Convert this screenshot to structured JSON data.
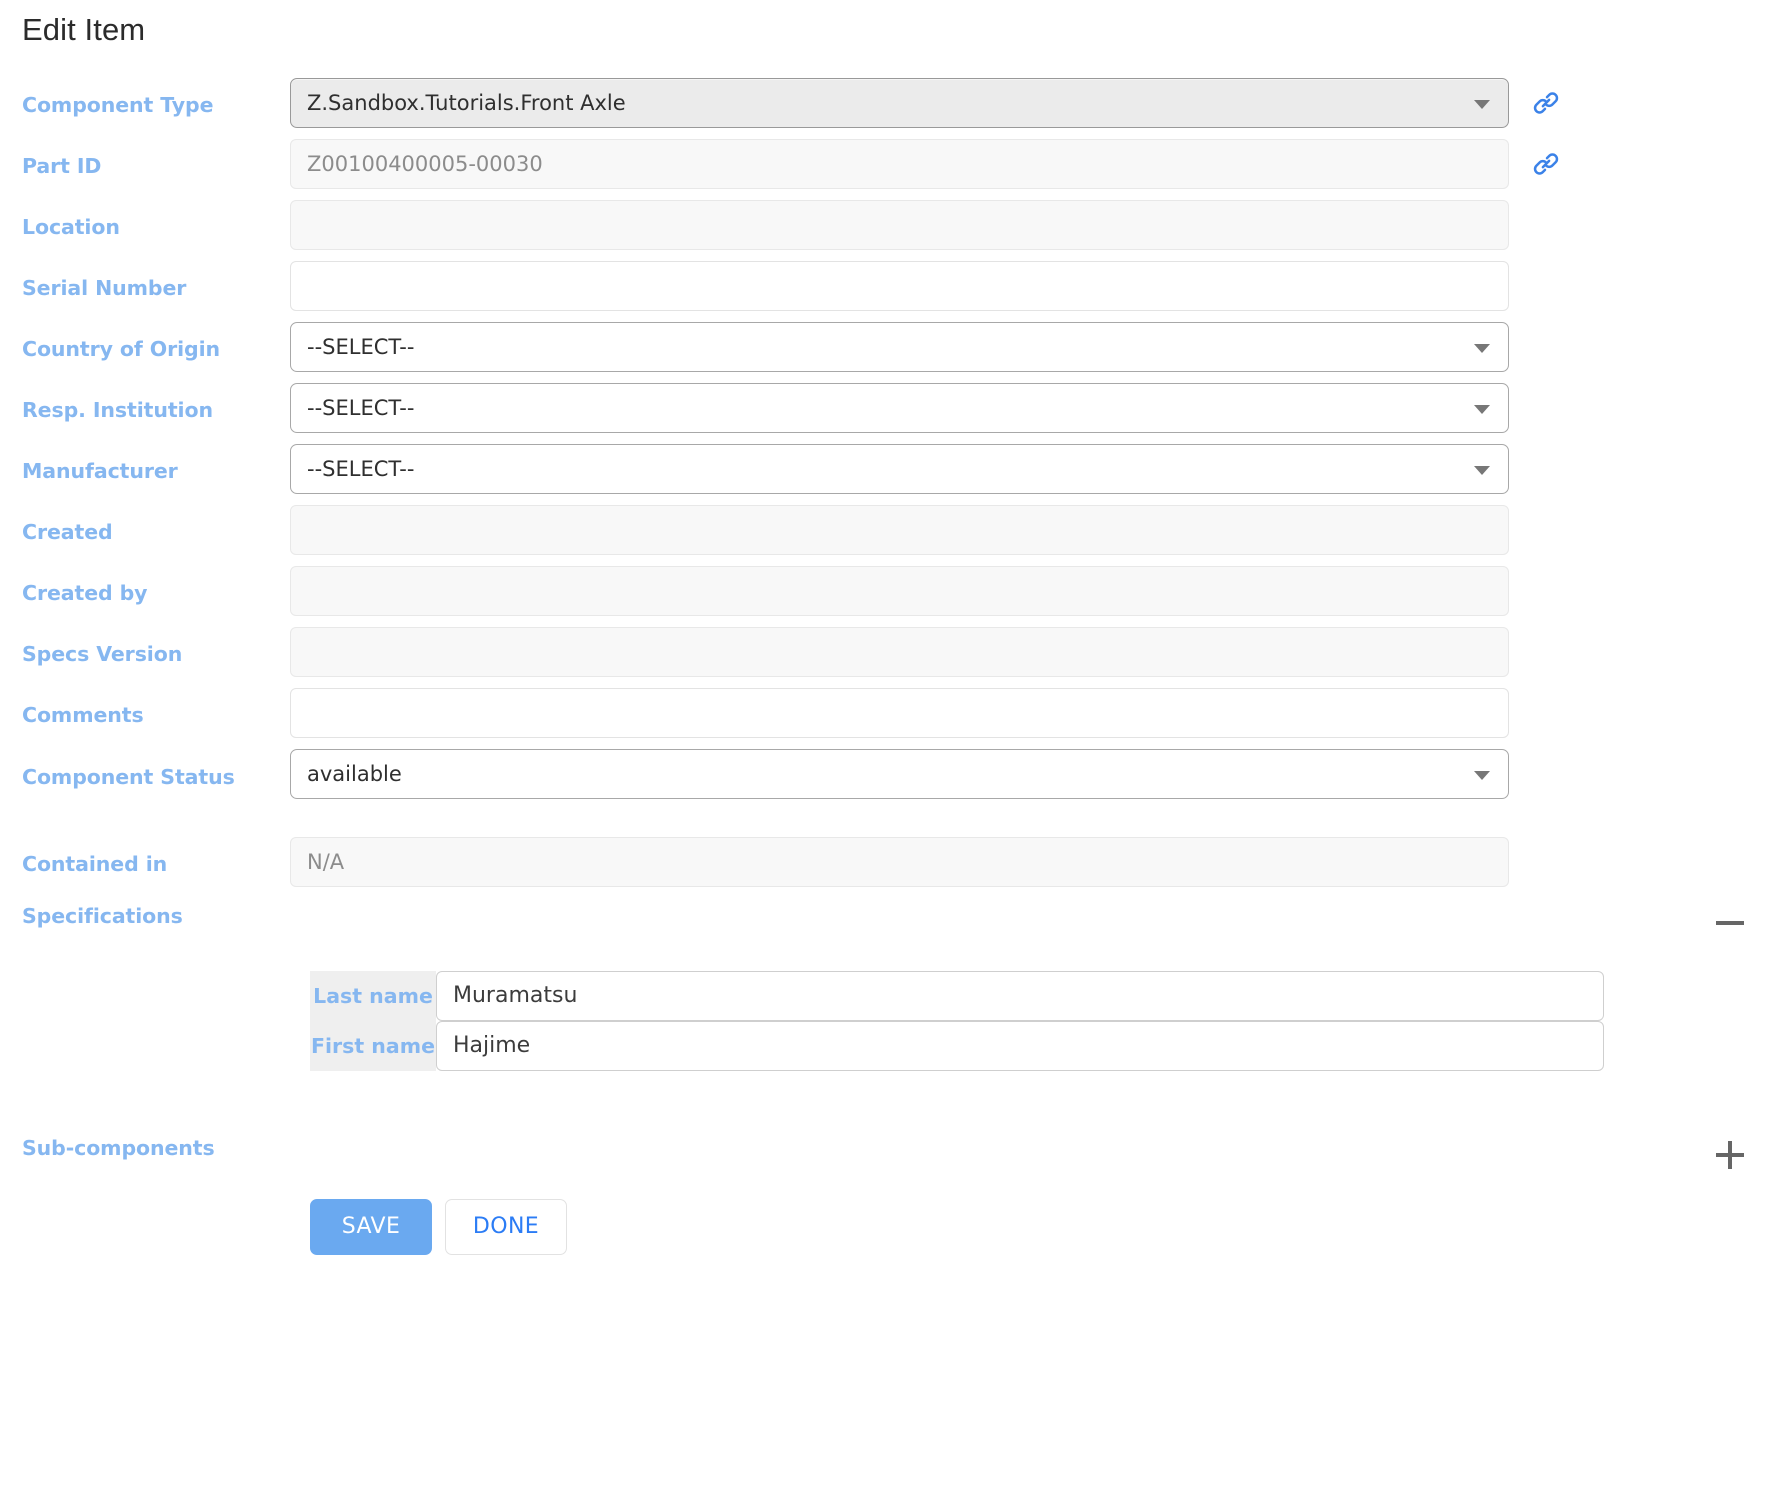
{
  "page": {
    "title": "Edit Item"
  },
  "fields": [
    {
      "label": "Component Type",
      "kind": "select-strong",
      "value": "Z.Sandbox.Tutorials.Front Axle",
      "link_icon": "link-icon",
      "name": "component-type"
    },
    {
      "label": "Part ID",
      "kind": "text-disabled",
      "value": "Z00100400005-00030",
      "link_icon": "link-icon",
      "name": "part-id"
    },
    {
      "label": "Location",
      "kind": "text-disabled",
      "value": "",
      "name": "location"
    },
    {
      "label": "Serial Number",
      "kind": "text",
      "value": "",
      "name": "serial-number"
    },
    {
      "label": "Country of Origin",
      "kind": "select",
      "value": "--SELECT--",
      "name": "country-of-origin"
    },
    {
      "label": "Resp. Institution",
      "kind": "select",
      "value": "--SELECT--",
      "name": "resp-institution"
    },
    {
      "label": "Manufacturer",
      "kind": "select",
      "value": "--SELECT--",
      "name": "manufacturer"
    },
    {
      "label": "Created",
      "kind": "text-disabled",
      "value": "",
      "name": "created"
    },
    {
      "label": "Created by",
      "kind": "text-disabled",
      "value": "",
      "name": "created-by"
    },
    {
      "label": "Specs Version",
      "kind": "text-disabled",
      "value": "",
      "name": "specs-version"
    },
    {
      "label": "Comments",
      "kind": "text",
      "value": "",
      "name": "comments"
    },
    {
      "label": "Component Status",
      "kind": "select",
      "value": "available",
      "name": "component-status"
    },
    {
      "label": "Contained in",
      "kind": "text-disabled",
      "value": "N/A",
      "name": "contained-in"
    }
  ],
  "specifications": {
    "label": "Specifications",
    "toggle": "minus-icon",
    "rows": [
      {
        "key": "Last name",
        "value": "Muramatsu"
      },
      {
        "key": "First name",
        "value": "Hajime"
      }
    ]
  },
  "subcomponents": {
    "label": "Sub-components",
    "toggle": "plus-icon"
  },
  "buttons": {
    "save": "SAVE",
    "done": "DONE"
  },
  "colors": {
    "label_blue": "#86b7f0",
    "save_blue": "#6aa9f0",
    "done_text_blue": "#2b7cf5",
    "link_blue": "#3b82e8",
    "title_gray": "#2b2b2b"
  }
}
